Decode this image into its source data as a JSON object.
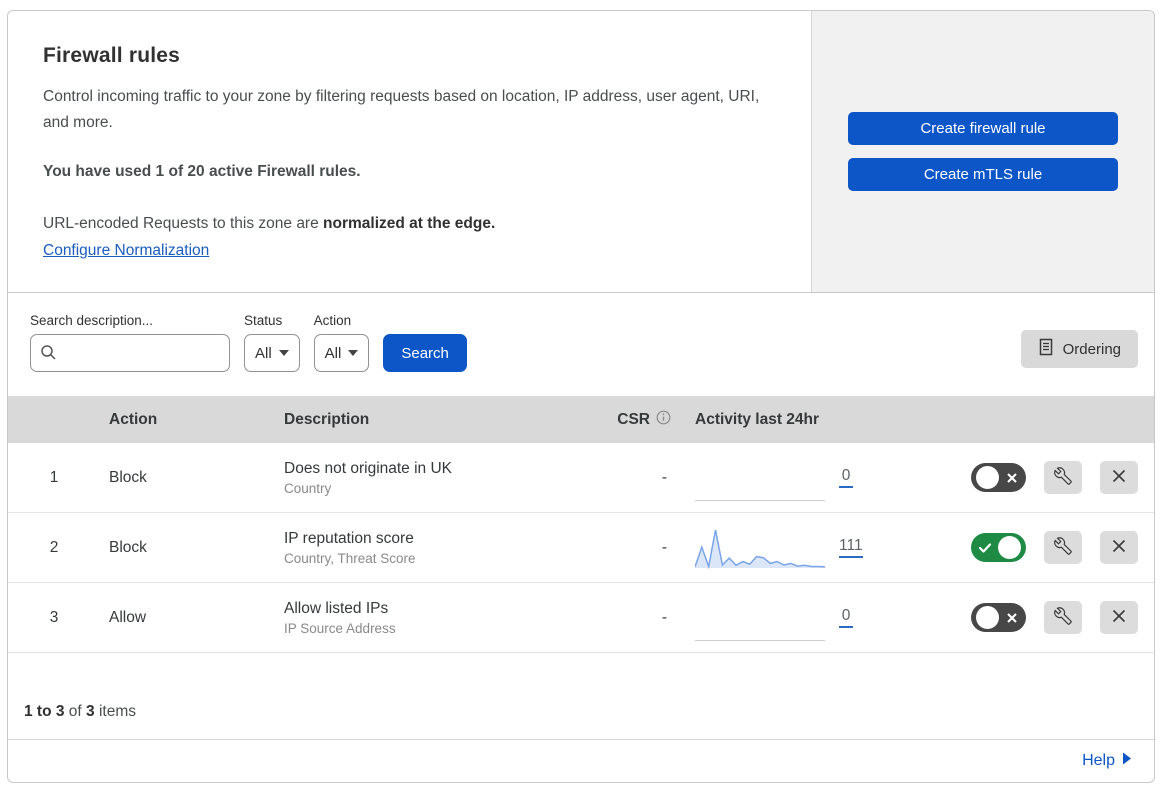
{
  "colors": {
    "accent_blue": "#0d56c8",
    "link_blue": "#1a5dbe",
    "toggle_on_green": "#1e8a44",
    "toggle_off_gray": "#474747",
    "panel_gray": "#f1f1f1",
    "table_header_gray": "#d9d9d9",
    "sparkline_blue": "#7aa5e8"
  },
  "header": {
    "title": "Firewall rules",
    "description": "Control incoming traffic to your zone by filtering requests based on location, IP address, user agent, URI, and more.",
    "usage_text": "You have used 1 of 20 active Firewall rules.",
    "normalization_prefix": "URL-encoded Requests to this zone are ",
    "normalization_bold": "normalized at the edge.",
    "normalization_link": "Configure Normalization",
    "create_firewall_button": "Create firewall rule",
    "create_mtls_button": "Create mTLS rule"
  },
  "filters": {
    "search_label": "Search description...",
    "search_value": "",
    "status_label": "Status",
    "status_value": "All",
    "action_label": "Action",
    "action_value": "All",
    "search_button": "Search",
    "ordering_button": "Ordering"
  },
  "table": {
    "columns": {
      "action": "Action",
      "description": "Description",
      "csr": "CSR",
      "activity": "Activity last 24hr"
    },
    "rows": [
      {
        "priority": "1",
        "action": "Block",
        "description": "Does not originate in UK",
        "criteria": "Country",
        "csr": "-",
        "activity_count": "0",
        "enabled": false,
        "sparkline": []
      },
      {
        "priority": "2",
        "action": "Block",
        "description": "IP reputation score",
        "criteria": "Country, Threat Score",
        "csr": "-",
        "activity_count": "111",
        "enabled": true,
        "sparkline": [
          3,
          55,
          4,
          100,
          8,
          26,
          7,
          17,
          10,
          30,
          27,
          12,
          17,
          8,
          12,
          5,
          7,
          4,
          4,
          3
        ]
      },
      {
        "priority": "3",
        "action": "Allow",
        "description": "Allow listed IPs",
        "criteria": "IP Source Address",
        "csr": "-",
        "activity_count": "0",
        "enabled": false,
        "sparkline": []
      }
    ]
  },
  "footer": {
    "range_bold": "1 to 3",
    "of_text": " of ",
    "total_bold": "3",
    "items_text": " items",
    "help_link": "Help"
  }
}
